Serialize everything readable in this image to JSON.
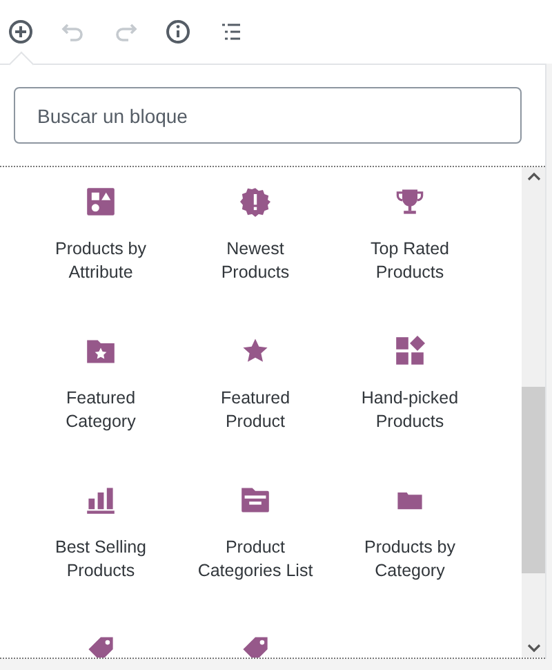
{
  "toolbar": [
    {
      "kind": "add",
      "disabled": false
    },
    {
      "kind": "undo",
      "disabled": true
    },
    {
      "kind": "redo",
      "disabled": true
    },
    {
      "kind": "info",
      "disabled": false
    },
    {
      "kind": "outline",
      "disabled": false
    }
  ],
  "search": {
    "placeholder": "Buscar un bloque"
  },
  "blocks": [
    {
      "kind": "attribute",
      "label": "Products by Attribute"
    },
    {
      "kind": "newest",
      "label": "Newest Products"
    },
    {
      "kind": "trophy",
      "label": "Top Rated Products"
    },
    {
      "kind": "featured-category",
      "label": "Featured Category"
    },
    {
      "kind": "star",
      "label": "Featured Product"
    },
    {
      "kind": "hand-picked",
      "label": "Hand-picked Products"
    },
    {
      "kind": "bar-chart",
      "label": "Best Selling Products"
    },
    {
      "kind": "categories-list",
      "label": "Product Categories List"
    },
    {
      "kind": "folder",
      "label": "Products by Category"
    },
    {
      "kind": "tag"
    },
    {
      "kind": "tag"
    }
  ]
}
